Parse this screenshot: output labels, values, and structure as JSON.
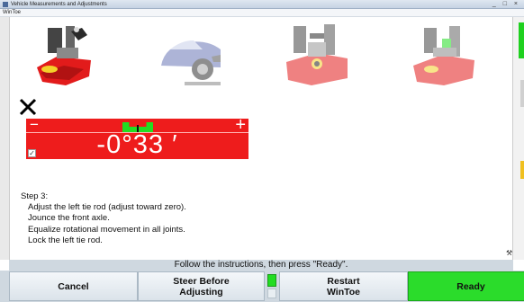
{
  "window": {
    "title": "Vehicle Measurements and Adjustments",
    "menu_label": "WinToe",
    "controls": "_ □ ×"
  },
  "thumbnails": [
    {
      "icon": "tie-rod-adjust-image",
      "active": true
    },
    {
      "icon": "vehicle-jounce-image",
      "active": false
    },
    {
      "icon": "joint-rotation-image",
      "active": false
    },
    {
      "icon": "tie-rod-lock-image",
      "active": false
    }
  ],
  "status_icon": "x-mark-icon",
  "gauge": {
    "minus": "−",
    "plus": "+",
    "value": "-0°33 ′",
    "check": "✓",
    "color": "#ee1c1c",
    "target_color": "#22dd22"
  },
  "instructions": {
    "heading": "Step 3:",
    "lines": [
      "Adjust the left tie rod (adjust toward zero).",
      "Jounce the front axle.",
      "Equalize rotational movement in all joints.",
      "Lock the left tie rod."
    ]
  },
  "status_message": "Follow the instructions, then press \"Ready\".",
  "buttons": {
    "cancel": "Cancel",
    "steer_before_adjusting": "Steer Before\nAdjusting",
    "restart_wintoe": "Restart\nWinToe",
    "ready": "Ready"
  },
  "tool_icon": "⚒"
}
